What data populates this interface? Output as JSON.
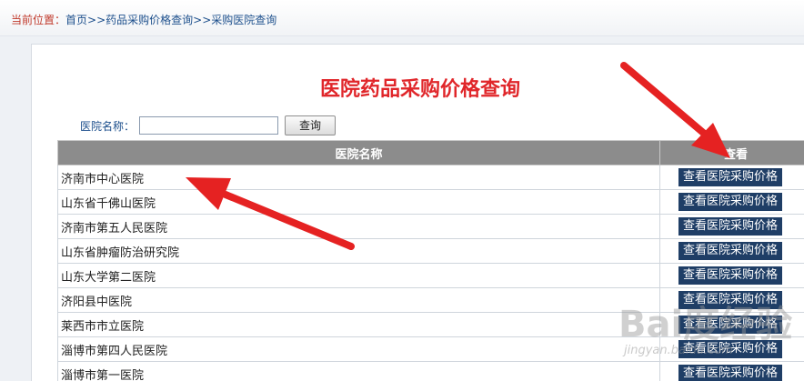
{
  "breadcrumb": {
    "label": "当前位置：",
    "items": [
      "首页",
      "药品采购价格查询",
      "采购医院查询"
    ],
    "separator": ">>"
  },
  "page": {
    "title": "医院药品采购价格查询",
    "title_color": "#e0262a"
  },
  "search": {
    "label": "医院名称：",
    "value": "",
    "placeholder": "",
    "button_label": "查询"
  },
  "table": {
    "columns": [
      "医院名称",
      "查看"
    ],
    "rows": [
      {
        "name": "济南市中心医院",
        "action": "查看医院采购价格"
      },
      {
        "name": "山东省千佛山医院",
        "action": "查看医院采购价格"
      },
      {
        "name": "济南市第五人民医院",
        "action": "查看医院采购价格"
      },
      {
        "name": "山东省肿瘤防治研究院",
        "action": "查看医院采购价格"
      },
      {
        "name": "山东大学第二医院",
        "action": "查看医院采购价格"
      },
      {
        "name": "济阳县中医院",
        "action": "查看医院采购价格"
      },
      {
        "name": "莱西市市立医院",
        "action": "查看医院采购价格"
      },
      {
        "name": "淄博市第四人民医院",
        "action": "查看医院采购价格"
      },
      {
        "name": "淄博市第一医院",
        "action": "查看医院采购价格"
      }
    ]
  },
  "colors": {
    "header_bg": "#8c8c8c",
    "button_bg": "#1f3e66",
    "annotation_arrow": "#e52222",
    "link": "#1c4f8c"
  },
  "watermark": {
    "logo": "Bai度经验",
    "sub": "jingyan.baidu.com"
  }
}
